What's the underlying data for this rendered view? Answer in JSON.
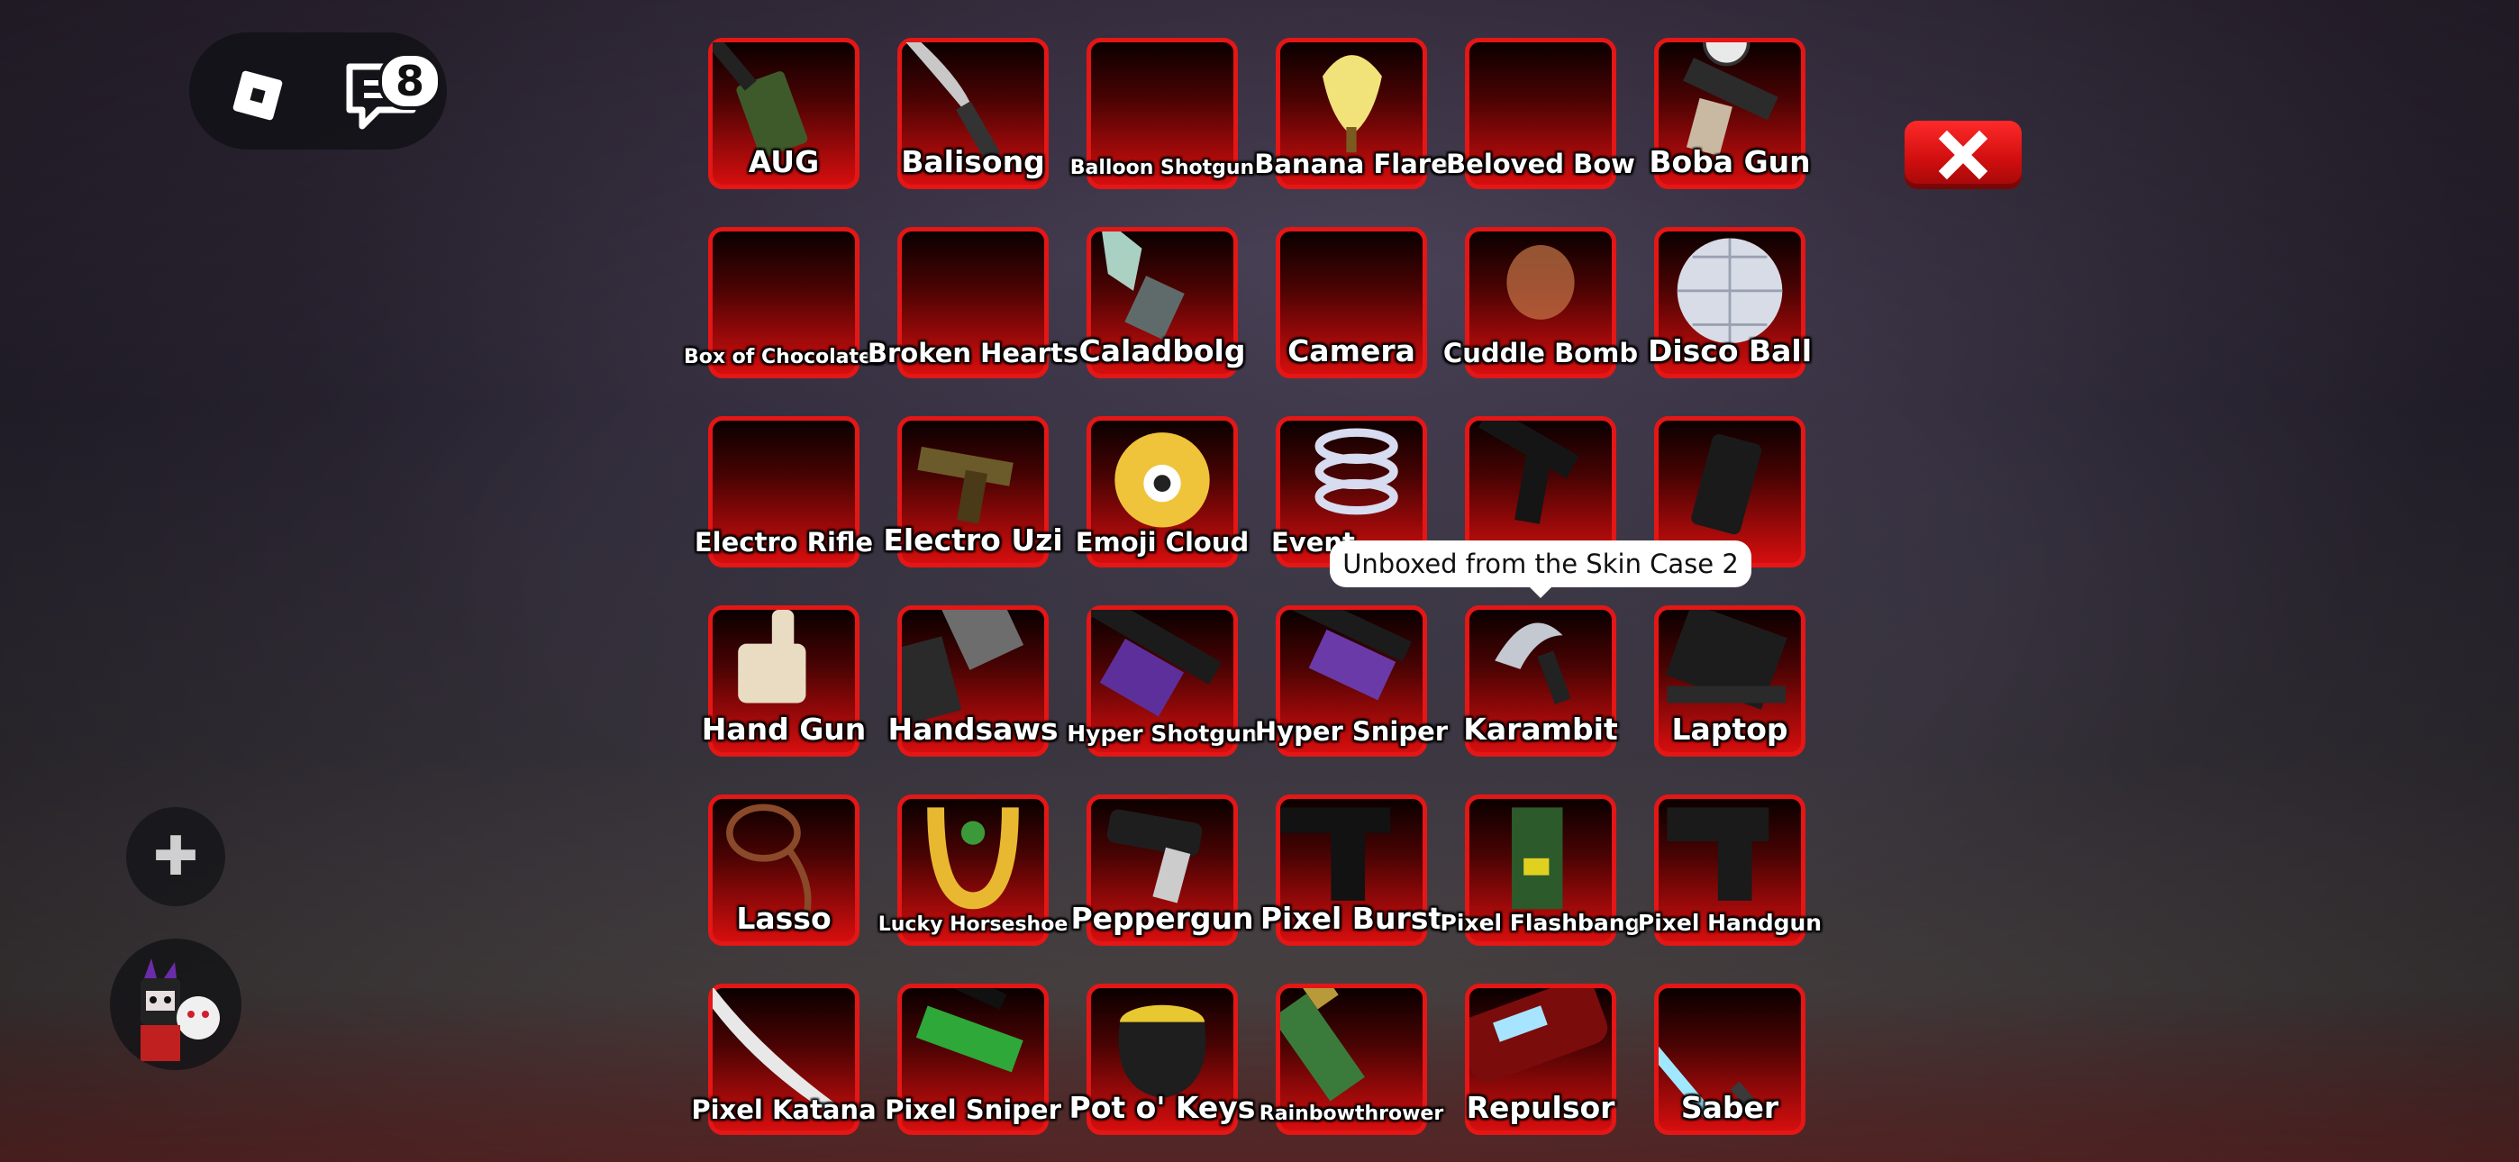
{
  "topbar": {
    "chat_badge_count": "8",
    "roblox_icon": "roblox-logo-icon",
    "chat_icon": "chat-icon"
  },
  "close_icon": "close-x-icon",
  "tooltip": {
    "text": "Unboxed from the Skin Case 2"
  },
  "inventory": {
    "items": [
      {
        "label": "AUG"
      },
      {
        "label": "Balisong"
      },
      {
        "label": "Balloon Shotgun"
      },
      {
        "label": "Banana Flare"
      },
      {
        "label": "Beloved Bow"
      },
      {
        "label": "Boba Gun"
      },
      {
        "label": "Box of Chocolates"
      },
      {
        "label": "Broken Hearts"
      },
      {
        "label": "Caladbolg"
      },
      {
        "label": "Camera"
      },
      {
        "label": "Cuddle Bomb"
      },
      {
        "label": "Disco Ball"
      },
      {
        "label": "Electro Rifle"
      },
      {
        "label": "Electro Uzi"
      },
      {
        "label": "Emoji Cloud"
      },
      {
        "label": "Event"
      },
      {
        "label": ""
      },
      {
        "label": ""
      },
      {
        "label": "Hand Gun"
      },
      {
        "label": "Handsaws"
      },
      {
        "label": "Hyper Shotgun"
      },
      {
        "label": "Hyper Sniper"
      },
      {
        "label": "Karambit"
      },
      {
        "label": "Laptop"
      },
      {
        "label": "Lasso"
      },
      {
        "label": "Lucky Horseshoe"
      },
      {
        "label": "Peppergun"
      },
      {
        "label": "Pixel Burst"
      },
      {
        "label": "Pixel Flashbang"
      },
      {
        "label": "Pixel Handgun"
      },
      {
        "label": "Pixel Katana"
      },
      {
        "label": "Pixel Sniper"
      },
      {
        "label": "Pot o' Keys"
      },
      {
        "label": "Rainbowthrower"
      },
      {
        "label": "Repulsor"
      },
      {
        "label": "Saber"
      }
    ]
  },
  "colors": {
    "tile_border": "#e51616",
    "tile_gradient_bottom": "#d60e0e",
    "close_button": "#ff2a2a"
  }
}
